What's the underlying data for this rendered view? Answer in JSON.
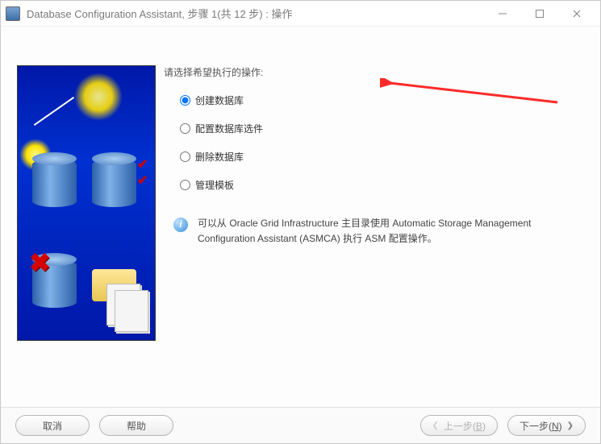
{
  "window": {
    "title": "Database Configuration Assistant, 步骤 1(共 12 步) : 操作"
  },
  "prompt": "请选择希望执行的操作:",
  "options": {
    "create": "创建数据库",
    "configure": "配置数据库选件",
    "delete": "删除数据库",
    "manage_templates": "管理模板",
    "selected": "create"
  },
  "info_text": "可以从 Oracle Grid Infrastructure 主目录使用 Automatic Storage Management Configuration Assistant (ASMCA) 执行 ASM 配置操作。",
  "buttons": {
    "cancel": "取消",
    "help": "帮助",
    "back_prefix": "上一步(",
    "back_key": "B",
    "back_suffix": ")",
    "next_prefix": "下一步(",
    "next_key": "N",
    "next_suffix": ")"
  }
}
